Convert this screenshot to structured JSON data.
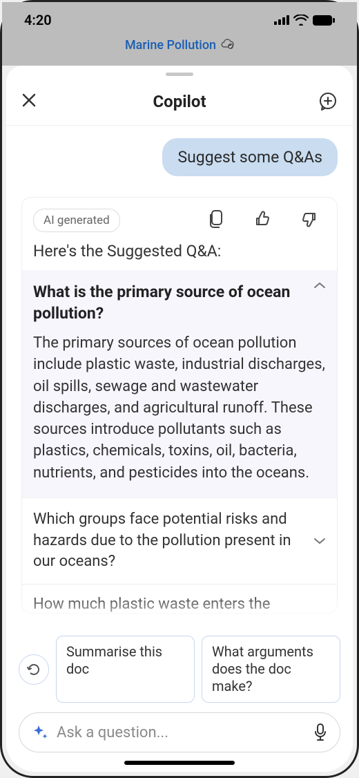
{
  "status": {
    "time": "4:20"
  },
  "doc": {
    "title": "Marine Pollution"
  },
  "sheet": {
    "title": "Copilot"
  },
  "chat": {
    "user_message": "Suggest some Q&As",
    "ai_badge": "AI generated",
    "ai_intro": "Here's the Suggested Q&A:",
    "qa": [
      {
        "question": "What is the primary source of ocean pollution?",
        "answer": "The primary sources of ocean pollution include plastic waste, industrial discharges, oil spills, sewage and wastewater discharges, and agricultural runoff. These sources introduce pollutants such as plastics, chemicals, toxins, oil, bacteria, nutrients, and pesticides into the oceans.",
        "expanded": true
      },
      {
        "question": "Which groups face potential risks and hazards due to the pollution present in our oceans?",
        "expanded": false
      },
      {
        "question_peek": "How much plastic waste enters the"
      }
    ]
  },
  "suggestions": {
    "chip1": "Summarise this doc",
    "chip2": "What arguments does the doc make?"
  },
  "input": {
    "placeholder": "Ask a question..."
  }
}
